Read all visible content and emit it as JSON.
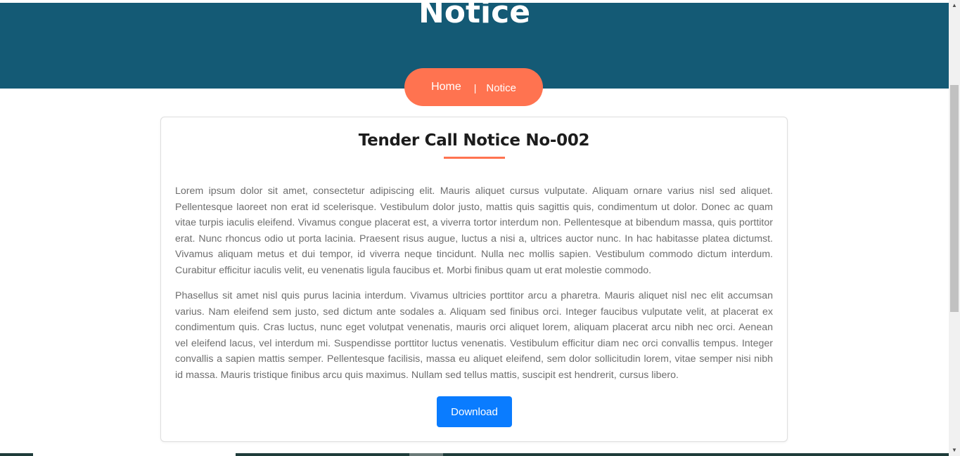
{
  "hero": {
    "title": "Notice"
  },
  "breadcrumb": {
    "home_label": "Home",
    "separator": "|",
    "current_label": "Notice"
  },
  "notice": {
    "title": "Tender Call Notice No-002",
    "paragraphs": [
      "Lorem ipsum dolor sit amet, consectetur adipiscing elit. Mauris aliquet cursus vulputate. Aliquam ornare varius nisl sed aliquet. Pellentesque laoreet non erat id scelerisque. Vestibulum dolor justo, mattis quis sagittis quis, condimentum ut dolor. Donec ac quam vitae turpis iaculis eleifend. Vivamus congue placerat est, a viverra tortor interdum non. Pellentesque at bibendum massa, quis porttitor erat. Nunc rhoncus odio ut porta lacinia. Praesent risus augue, luctus a nisi a, ultrices auctor nunc. In hac habitasse platea dictumst. Vivamus aliquam metus et dui tempor, id viverra neque tincidunt. Nulla nec mollis sapien. Vestibulum commodo dictum interdum. Curabitur efficitur iaculis velit, eu venenatis ligula faucibus et. Morbi finibus quam ut erat molestie commodo.",
      "Phasellus sit amet nisl quis purus lacinia interdum. Vivamus ultricies porttitor arcu a pharetra. Mauris aliquet nisl nec elit accumsan varius. Nam eleifend sem justo, sed dictum ante sodales a. Aliquam sed finibus orci. Integer faucibus vulputate velit, at placerat ex condimentum quis. Cras luctus, nunc eget volutpat venenatis, mauris orci aliquet lorem, aliquam placerat arcu nibh nec orci. Aenean vel eleifend lacus, vel interdum mi. Suspendisse porttitor luctus venenatis. Vestibulum efficitur diam nec orci convallis tempus. Integer convallis a sapien mattis semper. Pellentesque facilisis, massa eu aliquet eleifend, sem dolor sollicitudin lorem, vitae semper nisi nibh id massa. Mauris tristique finibus arcu quis maximus. Nullam sed tellus mattis, suscipit est hendrerit, cursus libero."
    ],
    "download_label": "Download"
  },
  "scrollbar": {
    "up_icon": "triangle-up-icon",
    "down_icon": "triangle-down-icon"
  },
  "colors": {
    "hero_background": "#145a75",
    "accent": "#ff7350",
    "download_button": "#0a7cff",
    "body_text": "#6e6e6e",
    "title_text": "#1c1c1c"
  }
}
